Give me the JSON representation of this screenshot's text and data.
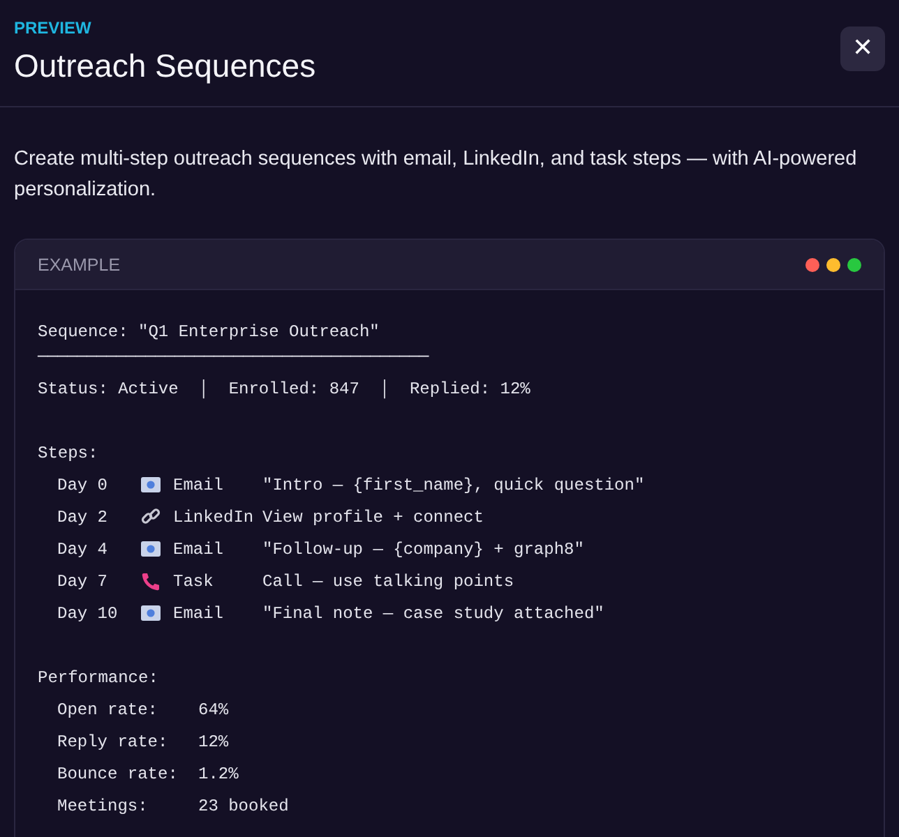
{
  "header": {
    "eyebrow": "PREVIEW",
    "title": "Outreach Sequences",
    "close_label": "✕"
  },
  "description": "Create multi-step outreach sequences with email, LinkedIn, and task steps — with AI-powered personalization.",
  "example": {
    "label": "EXAMPLE",
    "window_dots": [
      {
        "color": "#ff5f57"
      },
      {
        "color": "#febc2e"
      },
      {
        "color": "#28c840"
      }
    ],
    "sequence_line": "Sequence: \"Q1 Enterprise Outreach\"",
    "separator": "────────────────────────────────────────",
    "status_line": "Status: Active  │  Enrolled: 847  │  Replied: 12%",
    "steps_heading": "Steps:",
    "steps": [
      {
        "day": "Day 0",
        "kind": "email",
        "channel": "Email",
        "detail": "\"Intro — {first_name}, quick question\""
      },
      {
        "day": "Day 2",
        "kind": "link",
        "channel": "LinkedIn",
        "detail": "View profile + connect"
      },
      {
        "day": "Day 4",
        "kind": "email",
        "channel": "Email",
        "detail": "\"Follow-up — {company} + graph8\""
      },
      {
        "day": "Day 7",
        "kind": "phone",
        "channel": "Task",
        "detail": "Call — use talking points"
      },
      {
        "day": "Day 10",
        "kind": "email",
        "channel": "Email",
        "detail": "\"Final note — case study attached\""
      }
    ],
    "performance_heading": "Performance:",
    "metrics": [
      {
        "label": "Open rate:",
        "value": "64%"
      },
      {
        "label": "Reply rate:",
        "value": "12%"
      },
      {
        "label": "Bounce rate:",
        "value": "1.2%"
      },
      {
        "label": "Meetings:",
        "value": "23 booked"
      }
    ]
  }
}
